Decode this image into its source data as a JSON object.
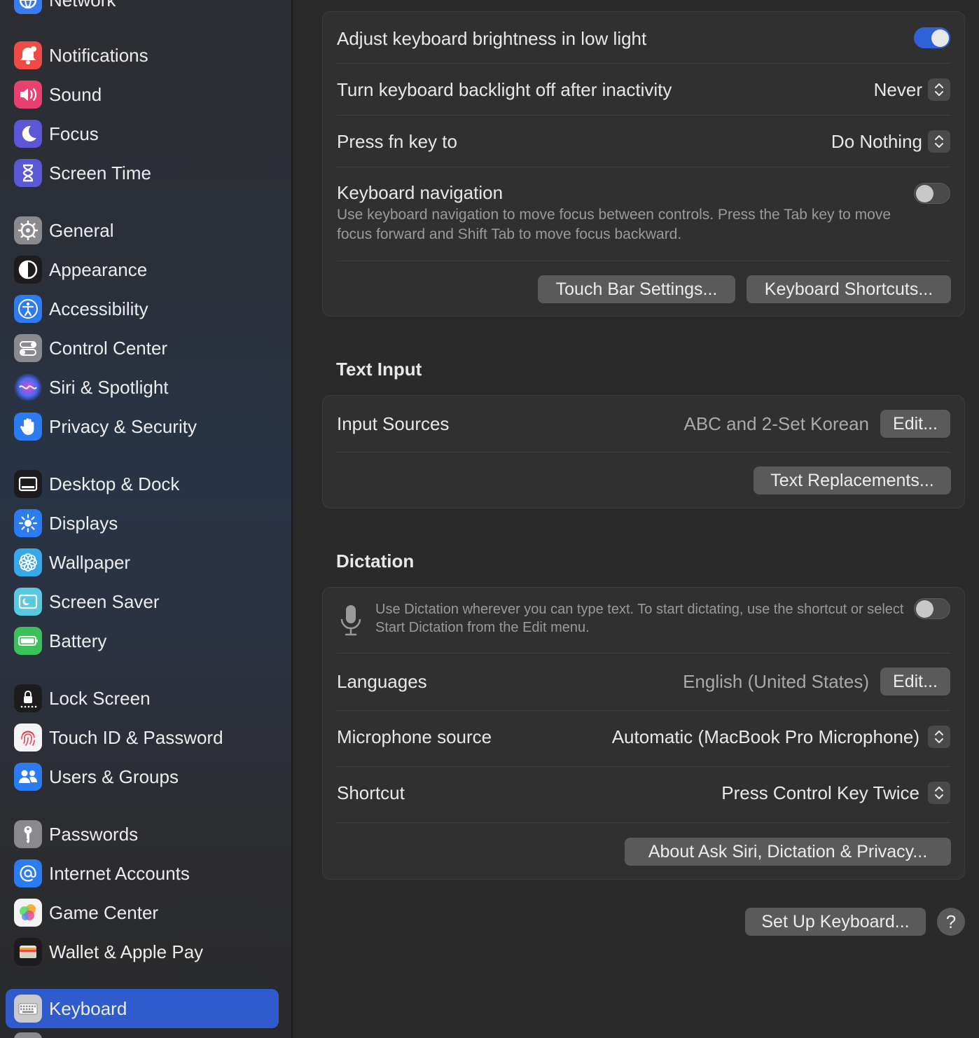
{
  "sidebar": {
    "items": [
      {
        "label": "Network",
        "icon": "network-icon"
      },
      {
        "label": "Notifications",
        "icon": "bell-icon"
      },
      {
        "label": "Sound",
        "icon": "speaker-icon"
      },
      {
        "label": "Focus",
        "icon": "moon-icon"
      },
      {
        "label": "Screen Time",
        "icon": "hourglass-icon"
      },
      {
        "label": "General",
        "icon": "gear-icon"
      },
      {
        "label": "Appearance",
        "icon": "appearance-icon"
      },
      {
        "label": "Accessibility",
        "icon": "accessibility-icon"
      },
      {
        "label": "Control Center",
        "icon": "switches-icon"
      },
      {
        "label": "Siri & Spotlight",
        "icon": "siri-icon"
      },
      {
        "label": "Privacy & Security",
        "icon": "hand-icon"
      },
      {
        "label": "Desktop & Dock",
        "icon": "dock-icon"
      },
      {
        "label": "Displays",
        "icon": "sun-icon"
      },
      {
        "label": "Wallpaper",
        "icon": "flower-icon"
      },
      {
        "label": "Screen Saver",
        "icon": "screen-saver-icon"
      },
      {
        "label": "Battery",
        "icon": "battery-icon"
      },
      {
        "label": "Lock Screen",
        "icon": "lock-icon"
      },
      {
        "label": "Touch ID & Password",
        "icon": "fingerprint-icon"
      },
      {
        "label": "Users & Groups",
        "icon": "users-icon"
      },
      {
        "label": "Passwords",
        "icon": "key-icon"
      },
      {
        "label": "Internet Accounts",
        "icon": "at-icon"
      },
      {
        "label": "Game Center",
        "icon": "game-center-icon"
      },
      {
        "label": "Wallet & Apple Pay",
        "icon": "wallet-icon"
      },
      {
        "label": "Keyboard",
        "icon": "keyboard-icon",
        "selected": true
      }
    ]
  },
  "keyboard_group": {
    "brightness_label": "Adjust keyboard brightness in low light",
    "brightness_on": true,
    "backlight_label": "Turn keyboard backlight off after inactivity",
    "backlight_value": "Never",
    "fn_label": "Press fn key to",
    "fn_value": "Do Nothing",
    "nav_label": "Keyboard navigation",
    "nav_desc": "Use keyboard navigation to move focus between controls. Press the Tab key to move focus forward and Shift Tab to move focus backward.",
    "nav_on": false,
    "touchbar_button": "Touch Bar Settings...",
    "shortcuts_button": "Keyboard Shortcuts..."
  },
  "text_input": {
    "title": "Text Input",
    "sources_label": "Input Sources",
    "sources_value": "ABC and 2-Set Korean",
    "edit_button": "Edit...",
    "replacements_button": "Text Replacements..."
  },
  "dictation": {
    "title": "Dictation",
    "desc": "Use Dictation wherever you can type text. To start dictating, use the shortcut or select Start Dictation from the Edit menu.",
    "enabled": false,
    "languages_label": "Languages",
    "languages_value": "English (United States)",
    "edit_button": "Edit...",
    "mic_label": "Microphone source",
    "mic_value": "Automatic (MacBook Pro Microphone)",
    "shortcut_label": "Shortcut",
    "shortcut_value": "Press Control Key Twice",
    "about_button": "About Ask Siri, Dictation & Privacy..."
  },
  "footer": {
    "setup_button": "Set Up Keyboard...",
    "help_label": "?"
  },
  "colors": {
    "accent": "#2f5bcc",
    "toggle_on": "#2f62d8"
  }
}
